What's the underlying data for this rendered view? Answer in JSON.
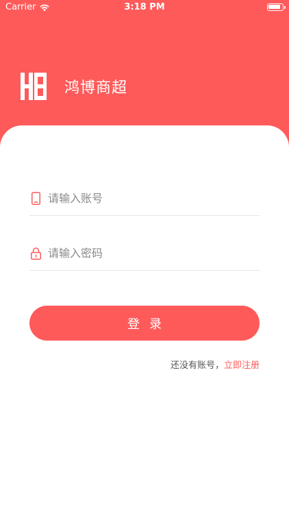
{
  "status_bar": {
    "carrier": "Carrier",
    "time": "3:18 PM"
  },
  "brand": {
    "name": "鸿博商超",
    "logo_icon": "hb-logo-icon"
  },
  "form": {
    "account_placeholder": "请输入账号",
    "password_placeholder": "请输入密码",
    "account_icon": "phone-icon",
    "password_icon": "lock-icon"
  },
  "login_button": "登录",
  "register": {
    "hint": "还没有账号，",
    "link": "立即注册"
  },
  "colors": {
    "accent": "#ff5a5a",
    "background": "#ffffff"
  }
}
